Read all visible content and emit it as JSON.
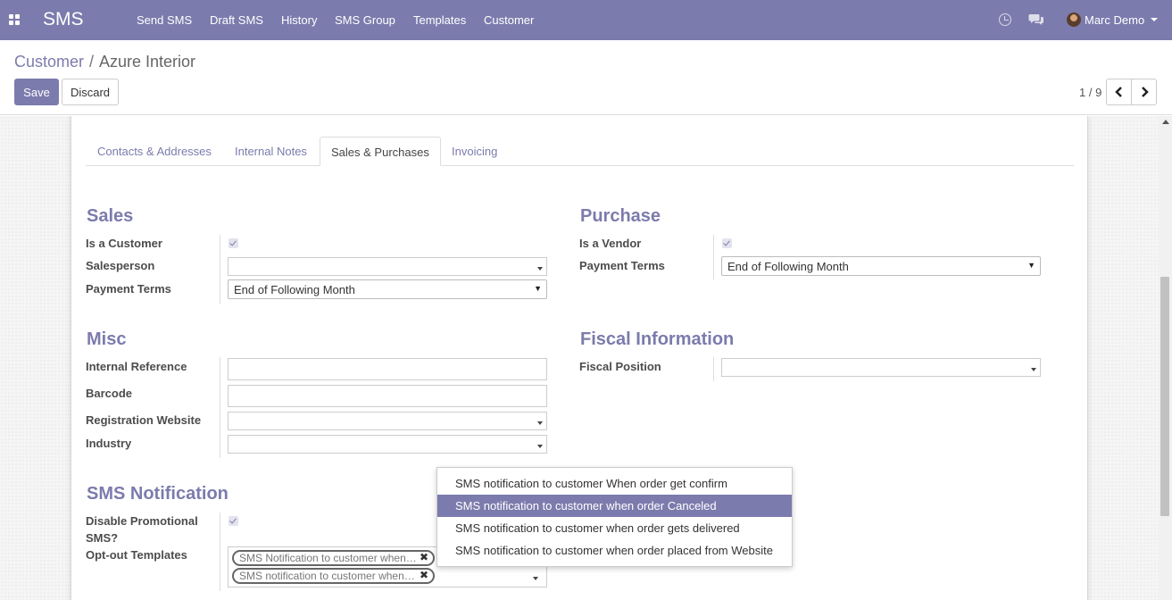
{
  "navbar": {
    "app_title": "SMS",
    "menu": [
      "Send SMS",
      "Draft SMS",
      "History",
      "SMS Group",
      "Templates",
      "Customer"
    ],
    "user_name": "Marc Demo",
    "icons": [
      "apps-icon",
      "clock-icon",
      "chat-icon",
      "avatar",
      "caret-down-icon"
    ]
  },
  "breadcrumb": {
    "parent": "Customer",
    "separator": "/",
    "current": "Azure Interior"
  },
  "buttons": {
    "save": "Save",
    "discard": "Discard"
  },
  "pager": {
    "value": "1 / 9"
  },
  "tabs": [
    {
      "label": "Contacts & Addresses",
      "active": false
    },
    {
      "label": "Internal Notes",
      "active": false
    },
    {
      "label": "Sales & Purchases",
      "active": true
    },
    {
      "label": "Invoicing",
      "active": false
    }
  ],
  "sales": {
    "title": "Sales",
    "is_customer_label": "Is a Customer",
    "is_customer": true,
    "salesperson_label": "Salesperson",
    "salesperson_value": "",
    "payment_terms_label": "Payment Terms",
    "payment_terms_value": "End of Following Month"
  },
  "purchase": {
    "title": "Purchase",
    "is_vendor_label": "Is a Vendor",
    "is_vendor": true,
    "payment_terms_label": "Payment Terms",
    "payment_terms_value": "End of Following Month"
  },
  "misc": {
    "title": "Misc",
    "internal_reference_label": "Internal Reference",
    "barcode_label": "Barcode",
    "registration_website_label": "Registration Website",
    "industry_label": "Industry"
  },
  "fiscal": {
    "title": "Fiscal Information",
    "fiscal_position_label": "Fiscal Position"
  },
  "sms_notification": {
    "title": "SMS Notification",
    "disable_promotional_label_1": "Disable Promotional",
    "disable_promotional_label_2": "SMS?",
    "disable_promotional": true,
    "optout_label": "Opt-out Templates",
    "optout_tags": [
      "SMS Notification to customer when…",
      "SMS notification to customer when…"
    ],
    "tag_remove_glyph": "✖"
  },
  "dropdown": {
    "items": [
      "SMS notification to customer When order get confirm",
      "SMS notification to customer when order Canceled",
      "SMS notification to customer when order gets delivered",
      "SMS notification to customer when order placed from Website"
    ],
    "highlighted": "SMS notification to customer when order Canceled"
  },
  "colors": {
    "brand": "#7c7bad",
    "text": "#4c4c4c"
  }
}
